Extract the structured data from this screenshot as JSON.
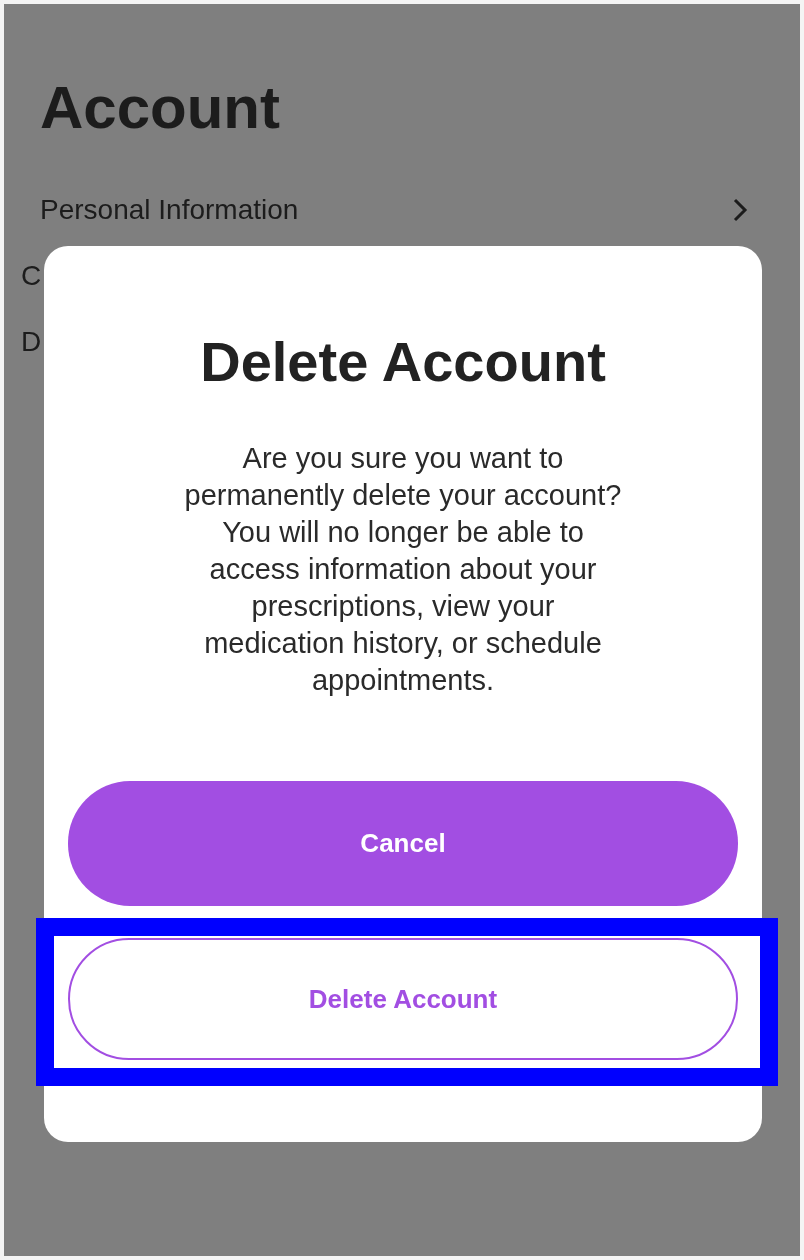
{
  "page": {
    "title": "Account",
    "items": [
      {
        "label": "Personal Information",
        "chevron": true
      },
      {
        "label": "C",
        "chevron": false
      },
      {
        "label": "D",
        "chevron": false
      }
    ]
  },
  "dialog": {
    "title": "Delete Account",
    "message": "Are you sure you want to permanently delete your account? You will no longer be able to access information about your prescriptions, view your medication history, or schedule appointments.",
    "buttons": [
      {
        "label": "Cancel",
        "kind": "primary",
        "highlighted": false
      },
      {
        "label": "Delete Account",
        "kind": "outline",
        "highlighted": true
      }
    ]
  }
}
